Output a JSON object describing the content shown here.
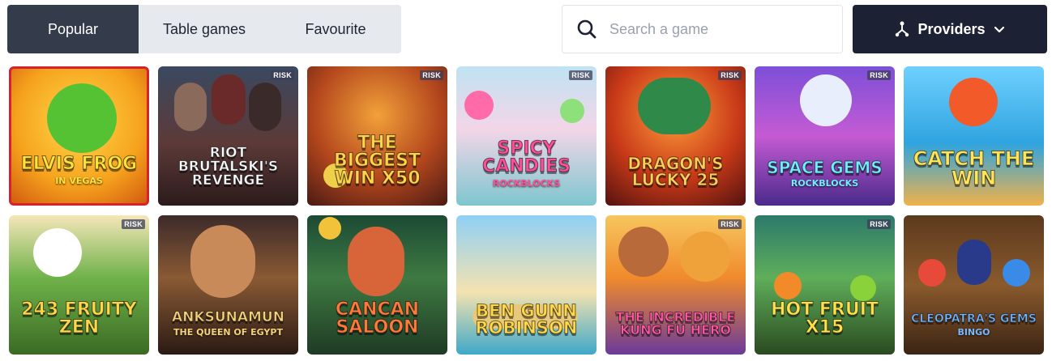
{
  "tabs": [
    {
      "label": "Popular",
      "active": true
    },
    {
      "label": "Table games",
      "active": false
    },
    {
      "label": "Favourite",
      "active": false
    }
  ],
  "search": {
    "placeholder": "Search a game",
    "icon": "search-icon"
  },
  "providers": {
    "label": "Providers",
    "icon": "providers-icon",
    "chevron": "chevron-down-icon"
  },
  "colors": {
    "tab_active_bg": "#343b4a",
    "tabs_bg": "#e6e9ee",
    "providers_bg": "#1c2233"
  },
  "games": [
    {
      "title": "ELVIS FROG",
      "subtitle": "IN VEGAS",
      "badge": ""
    },
    {
      "title": "RIOT BRUTALSKI'S REVENGE",
      "subtitle": "",
      "badge": "RISK"
    },
    {
      "title": "THE BIGGEST WIN X50",
      "subtitle": "",
      "badge": "RISK"
    },
    {
      "title": "SPICY CANDIES",
      "subtitle": "ROCKBLOCKS",
      "badge": "RISK"
    },
    {
      "title": "DRAGON'S LUCKY 25",
      "subtitle": "",
      "badge": "RISK"
    },
    {
      "title": "SPACE GEMS",
      "subtitle": "ROCKBLOCKS",
      "badge": "RISK"
    },
    {
      "title": "CATCH THE WIN",
      "subtitle": "",
      "badge": ""
    },
    {
      "title": "243 FRUITY ZEN",
      "subtitle": "",
      "badge": "RISK"
    },
    {
      "title": "ANKSUNAMUN",
      "subtitle": "THE QUEEN OF EGYPT",
      "badge": ""
    },
    {
      "title": "CANCAN SALOON",
      "subtitle": "",
      "badge": ""
    },
    {
      "title": "BEN GUNN ROBINSON",
      "subtitle": "",
      "badge": ""
    },
    {
      "title": "THE INCREDIBLE KUNG FU HERO",
      "subtitle": "",
      "badge": "RISK"
    },
    {
      "title": "HOT FRUIT X15",
      "subtitle": "",
      "badge": "RISK"
    },
    {
      "title": "CLEOPATRA'S GEMS",
      "subtitle": "BINGO",
      "badge": ""
    }
  ]
}
